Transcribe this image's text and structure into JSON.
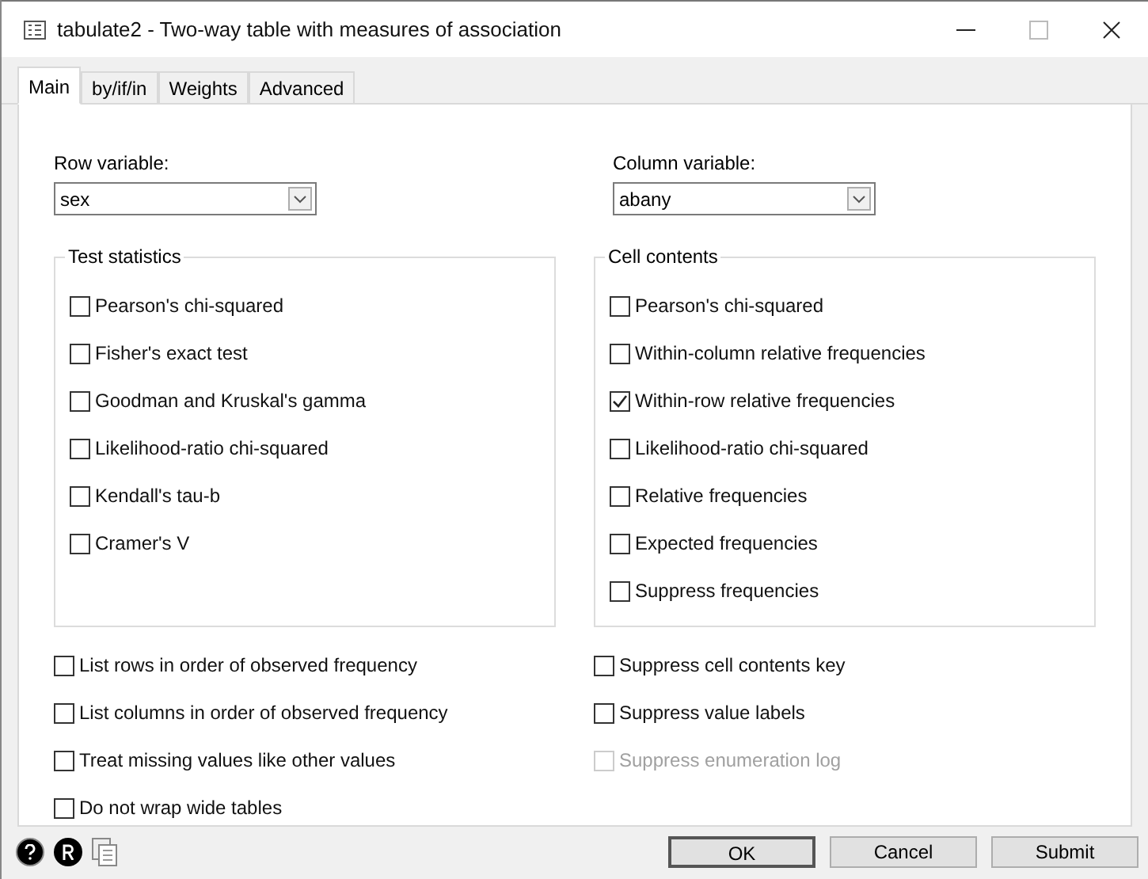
{
  "window": {
    "title": "tabulate2 - Two-way table with measures of association"
  },
  "tabs": [
    {
      "label": "Main",
      "selected": true
    },
    {
      "label": "by/if/in",
      "selected": false
    },
    {
      "label": "Weights",
      "selected": false
    },
    {
      "label": "Advanced",
      "selected": false
    }
  ],
  "row_variable": {
    "label": "Row variable:",
    "value": "sex"
  },
  "column_variable": {
    "label": "Column variable:",
    "value": "abany"
  },
  "test_statistics": {
    "title": "Test statistics",
    "options": [
      {
        "label": "Pearson's chi-squared",
        "checked": false
      },
      {
        "label": "Fisher's exact test",
        "checked": false
      },
      {
        "label": "Goodman and Kruskal's gamma",
        "checked": false
      },
      {
        "label": "Likelihood-ratio chi-squared",
        "checked": false
      },
      {
        "label": "Kendall's tau-b",
        "checked": false
      },
      {
        "label": "Cramer's V",
        "checked": false
      }
    ]
  },
  "cell_contents": {
    "title": "Cell contents",
    "options": [
      {
        "label": "Pearson's chi-squared",
        "checked": false
      },
      {
        "label": "Within-column relative frequencies",
        "checked": false
      },
      {
        "label": "Within-row relative frequencies",
        "checked": true
      },
      {
        "label": "Likelihood-ratio chi-squared",
        "checked": false
      },
      {
        "label": "Relative frequencies",
        "checked": false
      },
      {
        "label": "Expected frequencies",
        "checked": false
      },
      {
        "label": "Suppress frequencies",
        "checked": false
      }
    ]
  },
  "left_options": [
    {
      "label": "List rows in order of observed frequency",
      "checked": false,
      "disabled": false
    },
    {
      "label": "List columns in order of observed frequency",
      "checked": false,
      "disabled": false
    },
    {
      "label": "Treat missing values like other values",
      "checked": false,
      "disabled": false
    },
    {
      "label": "Do not wrap wide tables",
      "checked": false,
      "disabled": false
    }
  ],
  "right_options": [
    {
      "label": "Suppress cell contents key",
      "checked": false,
      "disabled": false
    },
    {
      "label": "Suppress value labels",
      "checked": false,
      "disabled": false
    },
    {
      "label": "Suppress enumeration log",
      "checked": false,
      "disabled": true
    }
  ],
  "buttons": [
    {
      "label": "OK",
      "default": true
    },
    {
      "label": "Cancel",
      "default": false
    },
    {
      "label": "Submit",
      "default": false
    }
  ]
}
